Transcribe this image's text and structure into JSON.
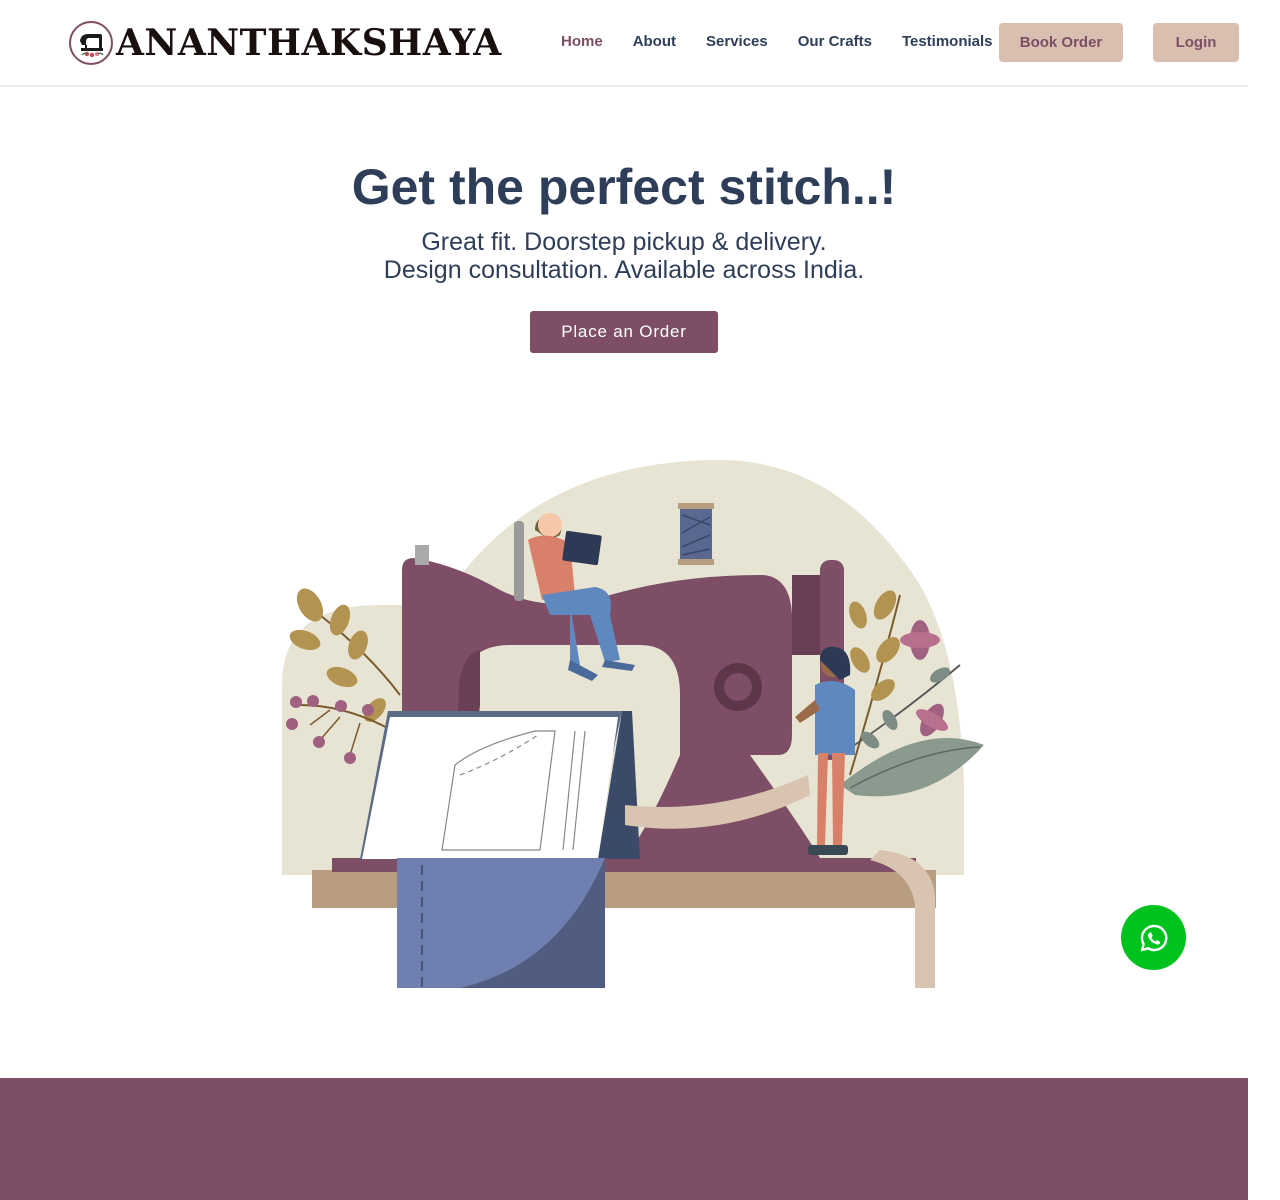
{
  "brand": {
    "name": "ANANTHAKSHAYA"
  },
  "nav": {
    "items": [
      {
        "label": "Home"
      },
      {
        "label": "About"
      },
      {
        "label": "Services"
      },
      {
        "label": "Our Crafts"
      },
      {
        "label": "Testimonials"
      }
    ],
    "book_order": "Book Order",
    "login": "Login"
  },
  "hero": {
    "title": "Get the perfect stitch..!",
    "subtitle_line1": "Great fit. Doorstep pickup & delivery.",
    "subtitle_line2": "Design consultation. Available across India.",
    "cta": "Place an Order"
  },
  "colors": {
    "accent": "#7d4e65",
    "navy": "#2f3e58",
    "tan_button": "#d8bfb0",
    "whatsapp": "#00c21f"
  },
  "icons": {
    "logo": "sewing-machine-logo-icon",
    "floating": "whatsapp-icon"
  }
}
